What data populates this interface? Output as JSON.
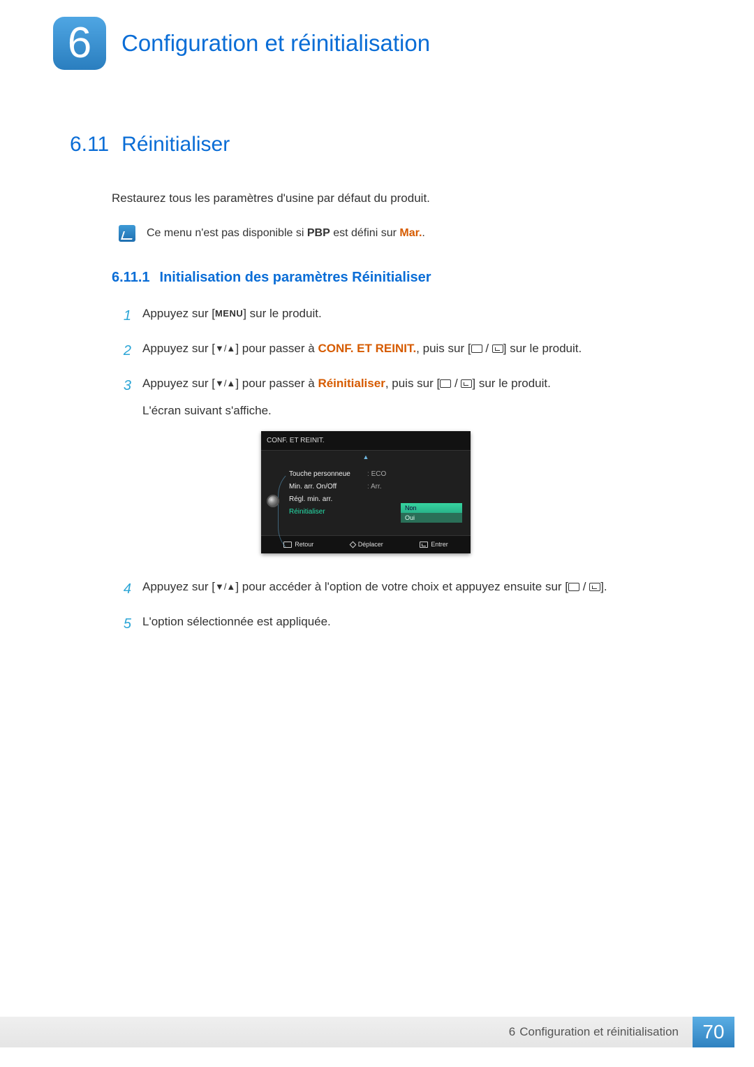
{
  "chapter": {
    "badge_num": "6",
    "title": "Configuration et réinitialisation"
  },
  "section": {
    "num": "6.11",
    "title": "Réinitialiser"
  },
  "intro_text": "Restaurez tous les paramètres d'usine par défaut du produit.",
  "note": {
    "prefix": "Ce menu n'est pas disponible si ",
    "bold_pbp": "PBP",
    "middle": " est défini sur ",
    "bold_mar": "Mar.",
    "suffix": "."
  },
  "subsection": {
    "num": "6.11.1",
    "title": "Initialisation des paramètres Réinitialiser"
  },
  "steps": {
    "s1_a": "Appuyez sur [",
    "s1_menu": "MENU",
    "s1_b": "] sur le produit.",
    "s2_a": "Appuyez sur [",
    "s2_arrows": "▼/▲",
    "s2_b": "] pour passer à ",
    "s2_conf": "CONF. ET REINIT.",
    "s2_c": ", puis sur [",
    "s2_d": "] sur le produit.",
    "s3_a": "Appuyez sur [",
    "s3_b": "] pour passer à ",
    "s3_reinit": "Réinitialiser",
    "s3_c": ", puis sur [",
    "s3_d": "] sur le produit.",
    "s3_e": "L'écran suivant s'affiche.",
    "s4_a": "Appuyez sur [",
    "s4_b": "] pour accéder à l'option de votre choix et appuyez ensuite sur [",
    "s4_c": "].",
    "s5": "L'option sélectionnée est appliquée."
  },
  "osd": {
    "title": "CONF. ET REINIT.",
    "items": [
      {
        "label": "Touche personneue",
        "value": "ECO"
      },
      {
        "label": "Min. arr. On/Off",
        "value": "Arr."
      },
      {
        "label": "Régl. min. arr.",
        "value": ""
      },
      {
        "label": "Réinitialiser",
        "value": ""
      }
    ],
    "popup": {
      "opt1": "Non",
      "opt2": "Oui"
    },
    "footer": {
      "back": "Retour",
      "move": "Déplacer",
      "enter": "Entrer"
    }
  },
  "footer": {
    "chapter_num": "6",
    "chapter_label": "Configuration et réinitialisation",
    "page_num": "70"
  }
}
